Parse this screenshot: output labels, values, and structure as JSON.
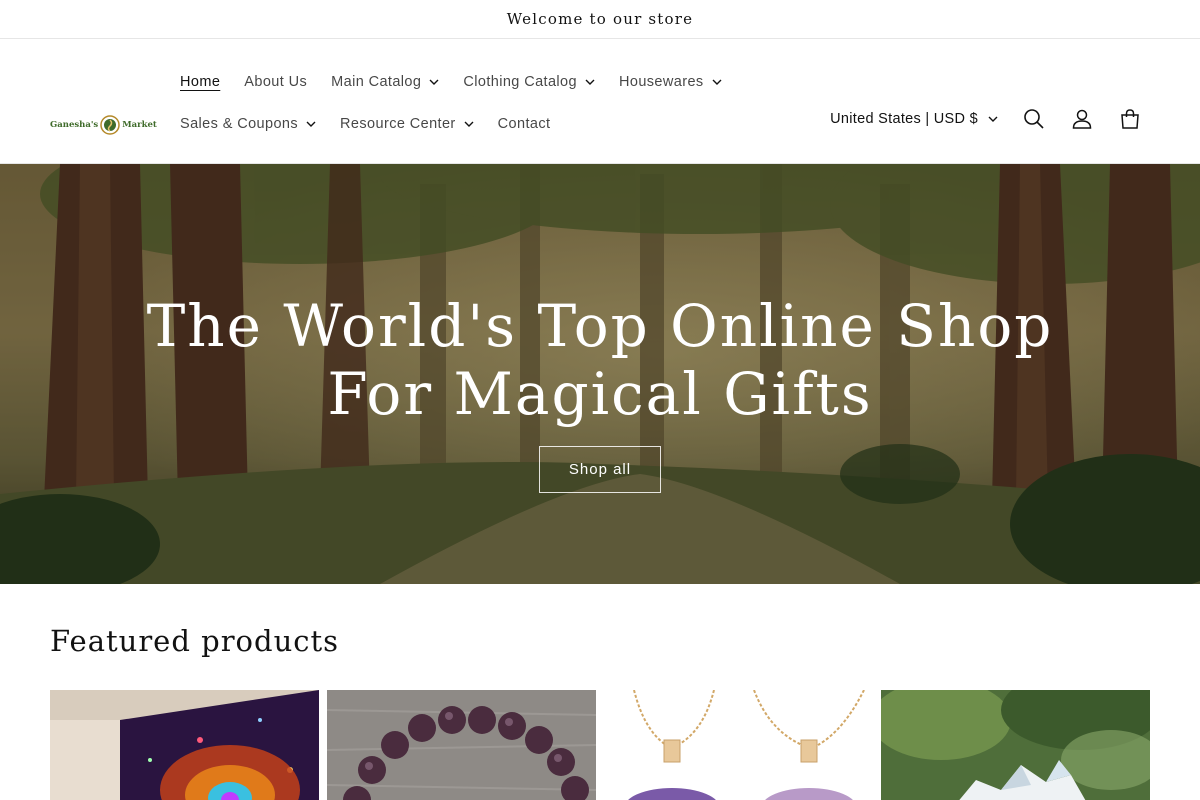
{
  "announcement": {
    "text": "Welcome to our store"
  },
  "logo": {
    "text": "Ganesha's Market"
  },
  "nav": {
    "row1": [
      {
        "label": "Home",
        "active": true,
        "dropdown": false
      },
      {
        "label": "About Us",
        "dropdown": false
      },
      {
        "label": "Main Catalog",
        "dropdown": true
      },
      {
        "label": "Clothing Catalog",
        "dropdown": true
      },
      {
        "label": "Housewares",
        "dropdown": true
      }
    ],
    "row2": [
      {
        "label": "Sales & Coupons",
        "dropdown": true
      },
      {
        "label": "Resource Center",
        "dropdown": true
      },
      {
        "label": "Contact",
        "dropdown": false
      }
    ]
  },
  "header": {
    "country_selector": "United States | USD $",
    "icons": [
      "search-icon",
      "account-icon",
      "cart-icon"
    ]
  },
  "hero": {
    "title_line1": "The World's Top Online Shop",
    "title_line2": "For Magical Gifts",
    "button_label": "Shop all"
  },
  "featured": {
    "title": "Featured products",
    "products": [
      {
        "image": "cosmic-mandala-tapestry"
      },
      {
        "image": "amethyst-bead-bracelet"
      },
      {
        "image": "purple-stone-pendant-necklaces"
      },
      {
        "image": "crystal-cluster"
      }
    ]
  },
  "colors": {
    "text": "#121212",
    "border": "#e6e6e6",
    "logo_green": "#3f6b2a",
    "hero_text": "#ffffff"
  }
}
